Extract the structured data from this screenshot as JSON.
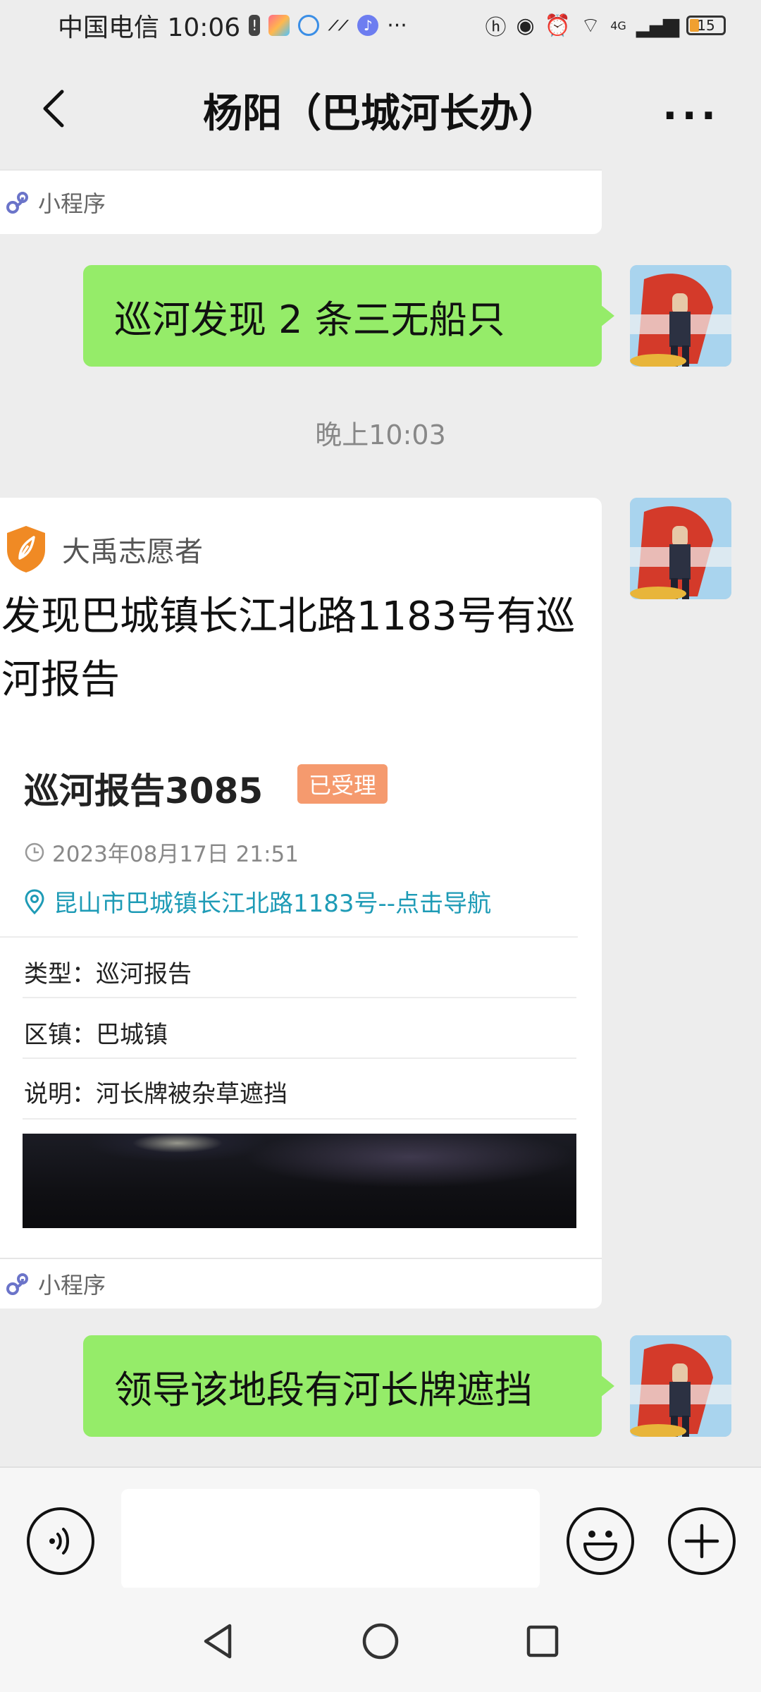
{
  "status_bar": {
    "carrier_time": "中国电信 10:06",
    "more": "···",
    "network": "4G",
    "battery": "15"
  },
  "header": {
    "title": "杨阳（巴城河长办）",
    "more": "···"
  },
  "messages": {
    "mini_program_label": "小程序",
    "msg1": "巡河发现 2 条三无船只",
    "timestamp": "晚上10:03",
    "card": {
      "source": "大禹志愿者",
      "headline": "发现巴城镇长江北路1183号有巡河报告",
      "report_title": "巡河报告3085",
      "status": "已受理",
      "datetime": "2023年08月17日 21:51",
      "location": "昆山市巴城镇长江北路1183号--点击导航",
      "type_row": "类型：巡河报告",
      "district_row": "区镇：巴城镇",
      "note_row": "说明：河长牌被杂草遮挡",
      "footer": "小程序"
    },
    "msg2": "领导该地段有河长牌遮挡"
  },
  "icons": {
    "back": "chevron-left-icon",
    "more": "more-dots-icon",
    "voice": "voice-icon",
    "emoji": "emoji-icon",
    "plus": "plus-icon",
    "nav_back": "triangle-back-icon",
    "nav_home": "circle-home-icon",
    "nav_recents": "square-recents-icon"
  },
  "colors": {
    "bubble_green": "#95ec69",
    "status_tag": "#f59a6e",
    "link_teal": "#1e9bb6",
    "source_orange": "#f08a24"
  }
}
